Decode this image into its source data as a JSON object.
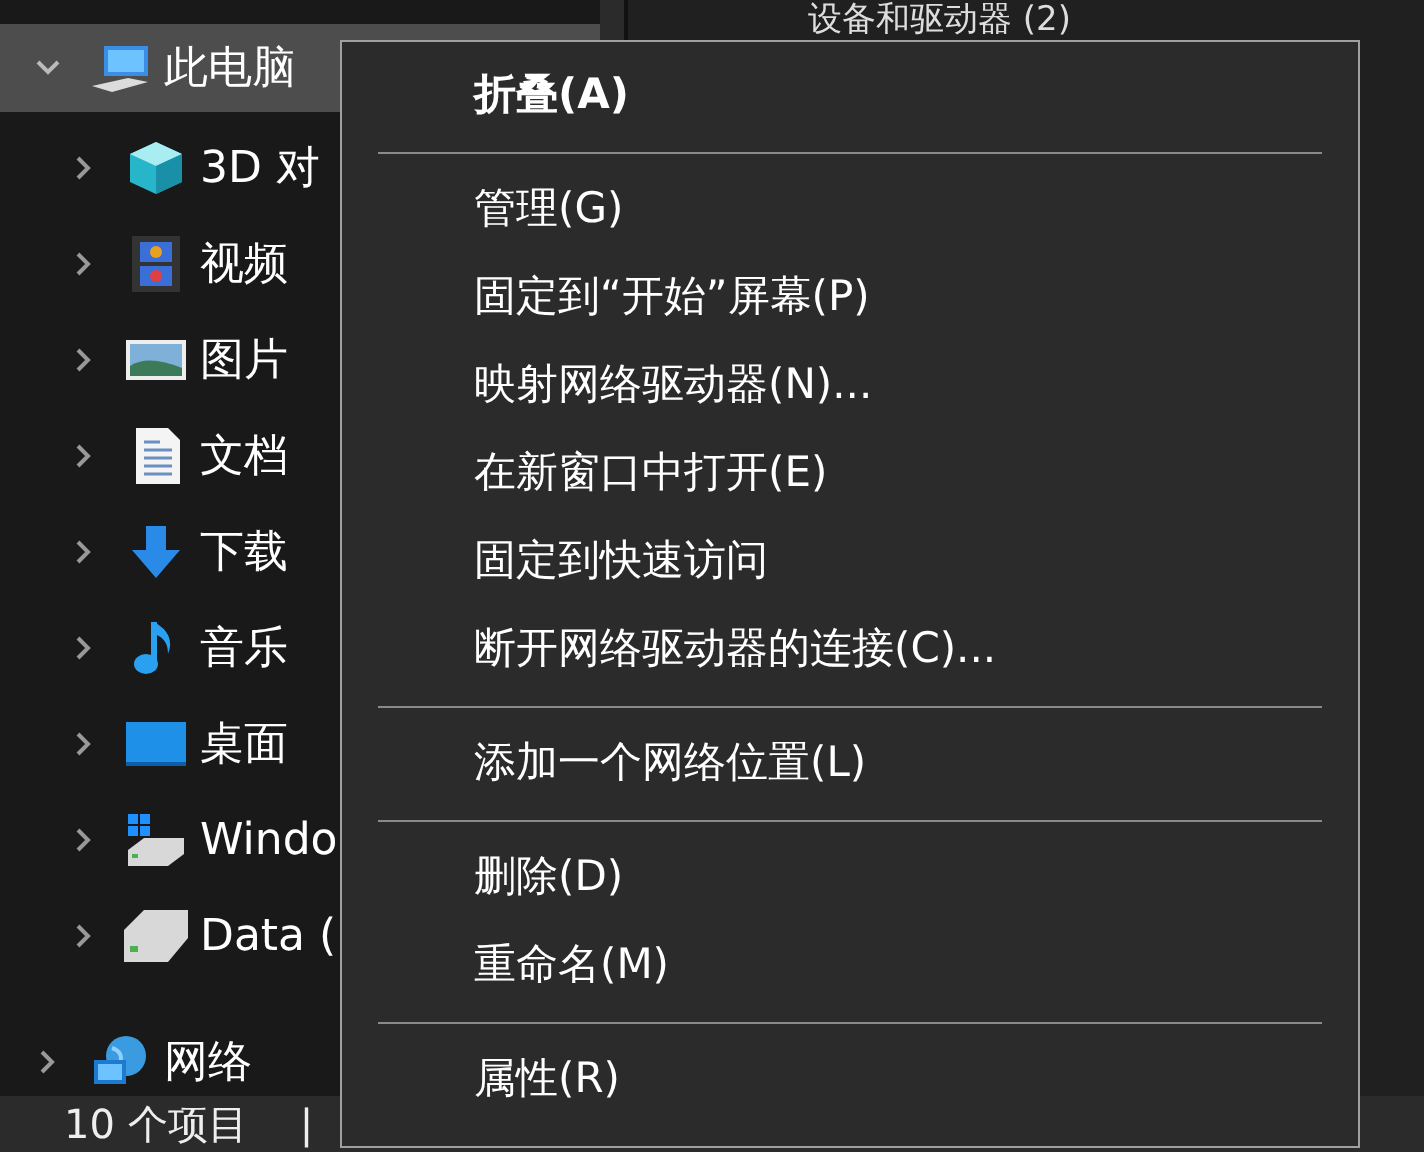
{
  "content_pane": {
    "group_heading": "设备和驱动器 (2)"
  },
  "navigation": {
    "items": [
      {
        "label": "此电脑",
        "expanded": true,
        "selected": true,
        "children": [
          {
            "label": "3D 对",
            "expanded": false,
            "selected": false
          },
          {
            "label": "视频",
            "expanded": false,
            "selected": false
          },
          {
            "label": "图片",
            "expanded": false,
            "selected": false
          },
          {
            "label": "文档",
            "expanded": false,
            "selected": false
          },
          {
            "label": "下载",
            "expanded": false,
            "selected": false
          },
          {
            "label": "音乐",
            "expanded": false,
            "selected": false
          },
          {
            "label": "桌面",
            "expanded": false,
            "selected": false
          },
          {
            "label": "Windo",
            "expanded": false,
            "selected": false
          },
          {
            "label": "Data (",
            "expanded": false,
            "selected": false
          }
        ]
      },
      {
        "label": "网络",
        "expanded": false,
        "selected": false
      }
    ]
  },
  "context_menu": {
    "items": [
      {
        "kind": "item",
        "label": "折叠(A)",
        "default": true
      },
      {
        "kind": "separator"
      },
      {
        "kind": "item",
        "label": "管理(G)",
        "default": false
      },
      {
        "kind": "item",
        "label": "固定到“开始”屏幕(P)",
        "default": false
      },
      {
        "kind": "item",
        "label": "映射网络驱动器(N)...",
        "default": false
      },
      {
        "kind": "item",
        "label": "在新窗口中打开(E)",
        "default": false
      },
      {
        "kind": "item",
        "label": "固定到快速访问",
        "default": false
      },
      {
        "kind": "item",
        "label": "断开网络驱动器的连接(C)...",
        "default": false
      },
      {
        "kind": "separator"
      },
      {
        "kind": "item",
        "label": "添加一个网络位置(L)",
        "default": false
      },
      {
        "kind": "separator"
      },
      {
        "kind": "item",
        "label": "删除(D)",
        "default": false
      },
      {
        "kind": "item",
        "label": "重命名(M)",
        "default": false
      },
      {
        "kind": "separator"
      },
      {
        "kind": "item",
        "label": "属性(R)",
        "default": false
      }
    ]
  },
  "status_bar": {
    "item_count": "10 个项目",
    "divider": "|"
  }
}
